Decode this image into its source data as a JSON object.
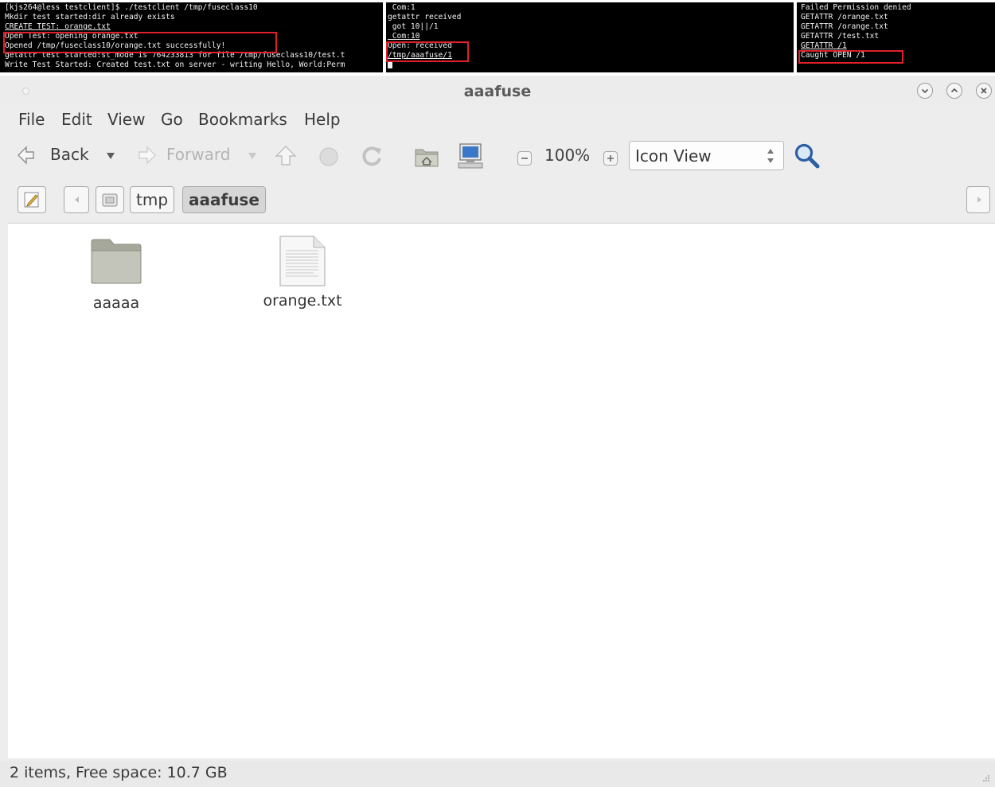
{
  "terminals": {
    "left": {
      "lines": [
        "[kjs264@less testclient]$ ./testclient /tmp/fuseclass10",
        "Mkdir test started:dir already exists",
        "CREATE TEST: orange.txt",
        "Open Test: opening orange.txt",
        "Opened /tmp/fuseclass10/orange.txt successfully!",
        "getattr test started:st_mode is 764233813 for file /tmp/fuseclass10/test.t",
        "Write Test Started: Created test.txt on server - writing Hello, World:Perm"
      ]
    },
    "middle": {
      "lines": [
        " Com:1",
        "getattr received",
        " got 10||/1",
        " Com:10",
        "Open: received",
        "/tmp/aaafuse/1"
      ]
    },
    "right": {
      "lines": [
        "Failed Permission denied",
        "GETATTR /orange.txt",
        "GETATTR /orange.txt",
        "GETATTR /test.txt",
        "GETATTR /1",
        "Caught OPEN /1"
      ]
    },
    "highlight_color": "#e0202a"
  },
  "window": {
    "title": "aaafuse",
    "menu": [
      "File",
      "Edit",
      "View",
      "Go",
      "Bookmarks",
      "Help"
    ],
    "toolbar": {
      "back_label": "Back",
      "forward_label": "Forward",
      "zoom_level": "100%",
      "view_mode": "Icon View"
    },
    "breadcrumbs": [
      "tmp",
      "aaafuse"
    ],
    "items": [
      {
        "name": "aaaaa",
        "type": "folder-icon"
      },
      {
        "name": "orange.txt",
        "type": "text-file-icon"
      }
    ],
    "status": "2 items, Free space: 10.7 GB"
  }
}
